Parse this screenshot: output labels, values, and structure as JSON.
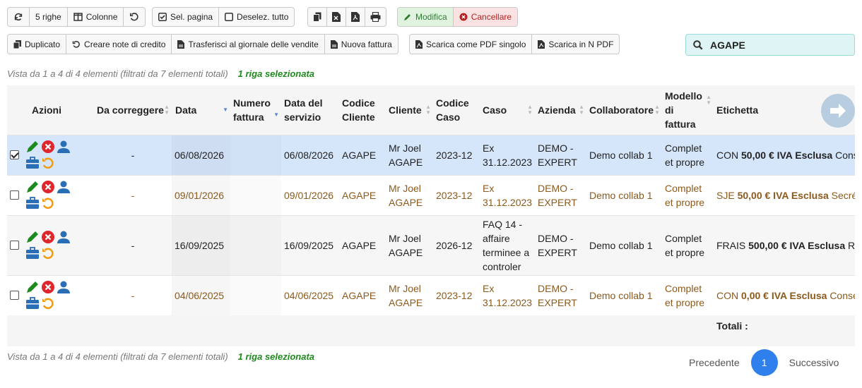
{
  "toolbar": {
    "rows_label": "5 righe",
    "columns_label": "Colonne",
    "select_page_label": "Sel. pagina",
    "deselect_all_label": "Deselez. tutto",
    "modify_label": "Modifica",
    "cancel_label": "Cancellare",
    "duplicate_label": "Duplicato",
    "credit_note_label": "Creare note di credito",
    "transfer_label": "Trasferisci al giornale delle vendite",
    "new_invoice_label": "Nuova fattura",
    "single_pdf_label": "Scarica come PDF singolo",
    "n_pdf_label": "Scarica in N PDF"
  },
  "search": {
    "value": "AGAPE"
  },
  "info": {
    "text": "Vista da 1 a 4 di 4 elementi (filtrati da 7 elementi totali)",
    "selected": "1 riga selezionata"
  },
  "table": {
    "headers": {
      "azioni": "Azioni",
      "da_correggere": "Da correggere",
      "data": "Data",
      "numero_fattura_1": "Numero",
      "numero_fattura_2": "fattura",
      "data_servizio_1": "Data del",
      "data_servizio_2": "servizio",
      "codice_cliente_1": "Codice",
      "codice_cliente_2": "Cliente",
      "cliente": "Cliente",
      "codice_caso_1": "Codice",
      "codice_caso_2": "Caso",
      "caso": "Caso",
      "azienda": "Azienda",
      "collaboratore": "Collaboratore",
      "modello_1": "Modello",
      "modello_2": "di",
      "modello_3": "fattura",
      "etichetta": "Etichetta"
    },
    "rows": [
      {
        "da_correggere": "-",
        "data": "06/08/2026",
        "numero_fattura": "",
        "data_servizio": "06/08/2026",
        "codice_cliente": "AGAPE",
        "cliente_1": "Mr Joel",
        "cliente_2": "AGAPE",
        "codice_caso": "2023-12",
        "caso_1": "Ex",
        "caso_2": "31.12.2023",
        "azienda_1": "DEMO -",
        "azienda_2": "EXPERT",
        "collaboratore": "Demo collab 1",
        "modello_1": "Complet",
        "modello_2": "et propre",
        "etichetta_prefix": "CON",
        "etichetta_amount": "50,00 € IVA Esclusa",
        "etichetta_suffix": "Consei"
      },
      {
        "da_correggere": "-",
        "data": "09/01/2026",
        "numero_fattura": "",
        "data_servizio": "09/01/2026",
        "codice_cliente": "AGAPE",
        "cliente_1": "Mr Joel",
        "cliente_2": "AGAPE",
        "codice_caso": "2023-12",
        "caso_1": "Ex",
        "caso_2": "31.12.2023",
        "azienda_1": "DEMO -",
        "azienda_2": "EXPERT",
        "collaboratore": "Demo collab 1",
        "modello_1": "Complet",
        "modello_2": "et propre",
        "etichetta_prefix": "SJE",
        "etichetta_amount": "50,00 € IVA Esclusa",
        "etichetta_suffix": "Secrét"
      },
      {
        "da_correggere": "-",
        "data": "16/09/2025",
        "numero_fattura": "",
        "data_servizio": "16/09/2025",
        "codice_cliente": "AGAPE",
        "cliente_1": "Mr Joel",
        "cliente_2": "AGAPE",
        "codice_caso": "2026-12",
        "caso_1": "FAQ 14 -",
        "caso_2": "affaire",
        "caso_3": "terminee a",
        "caso_4": "controler",
        "azienda_1": "DEMO -",
        "azienda_2": "EXPERT",
        "collaboratore": "Demo collab 1",
        "modello_1": "Complet",
        "modello_2": "et propre",
        "etichetta_prefix": "FRAIS",
        "etichetta_amount": "500,00 € IVA Esclusa",
        "etichetta_suffix": "Ref"
      },
      {
        "da_correggere": "-",
        "data": "04/06/2025",
        "numero_fattura": "",
        "data_servizio": "04/06/2025",
        "codice_cliente": "AGAPE",
        "cliente_1": "Mr Joel",
        "cliente_2": "AGAPE",
        "codice_caso": "2023-12",
        "caso_1": "Ex",
        "caso_2": "31.12.2023",
        "azienda_1": "DEMO -",
        "azienda_2": "EXPERT",
        "collaboratore": "Demo collab 1",
        "modello_1": "Complet",
        "modello_2": "et propre",
        "etichetta_prefix": "CON",
        "etichetta_amount": "0,00 € IVA Esclusa",
        "etichetta_suffix": "Consei"
      }
    ],
    "totals_label": "Totali :"
  },
  "pagination": {
    "prev_label": "Precedente",
    "current_page": "1",
    "next_label": "Successivo"
  },
  "colors": {
    "accent_blue": "#2f80ed",
    "selected_row": "#d6e6fa",
    "brown_text": "#8b5a1c",
    "green": "#1d8a1d",
    "red": "#e0262d",
    "orange": "#f39c12",
    "search_bg": "#dff5f5"
  }
}
